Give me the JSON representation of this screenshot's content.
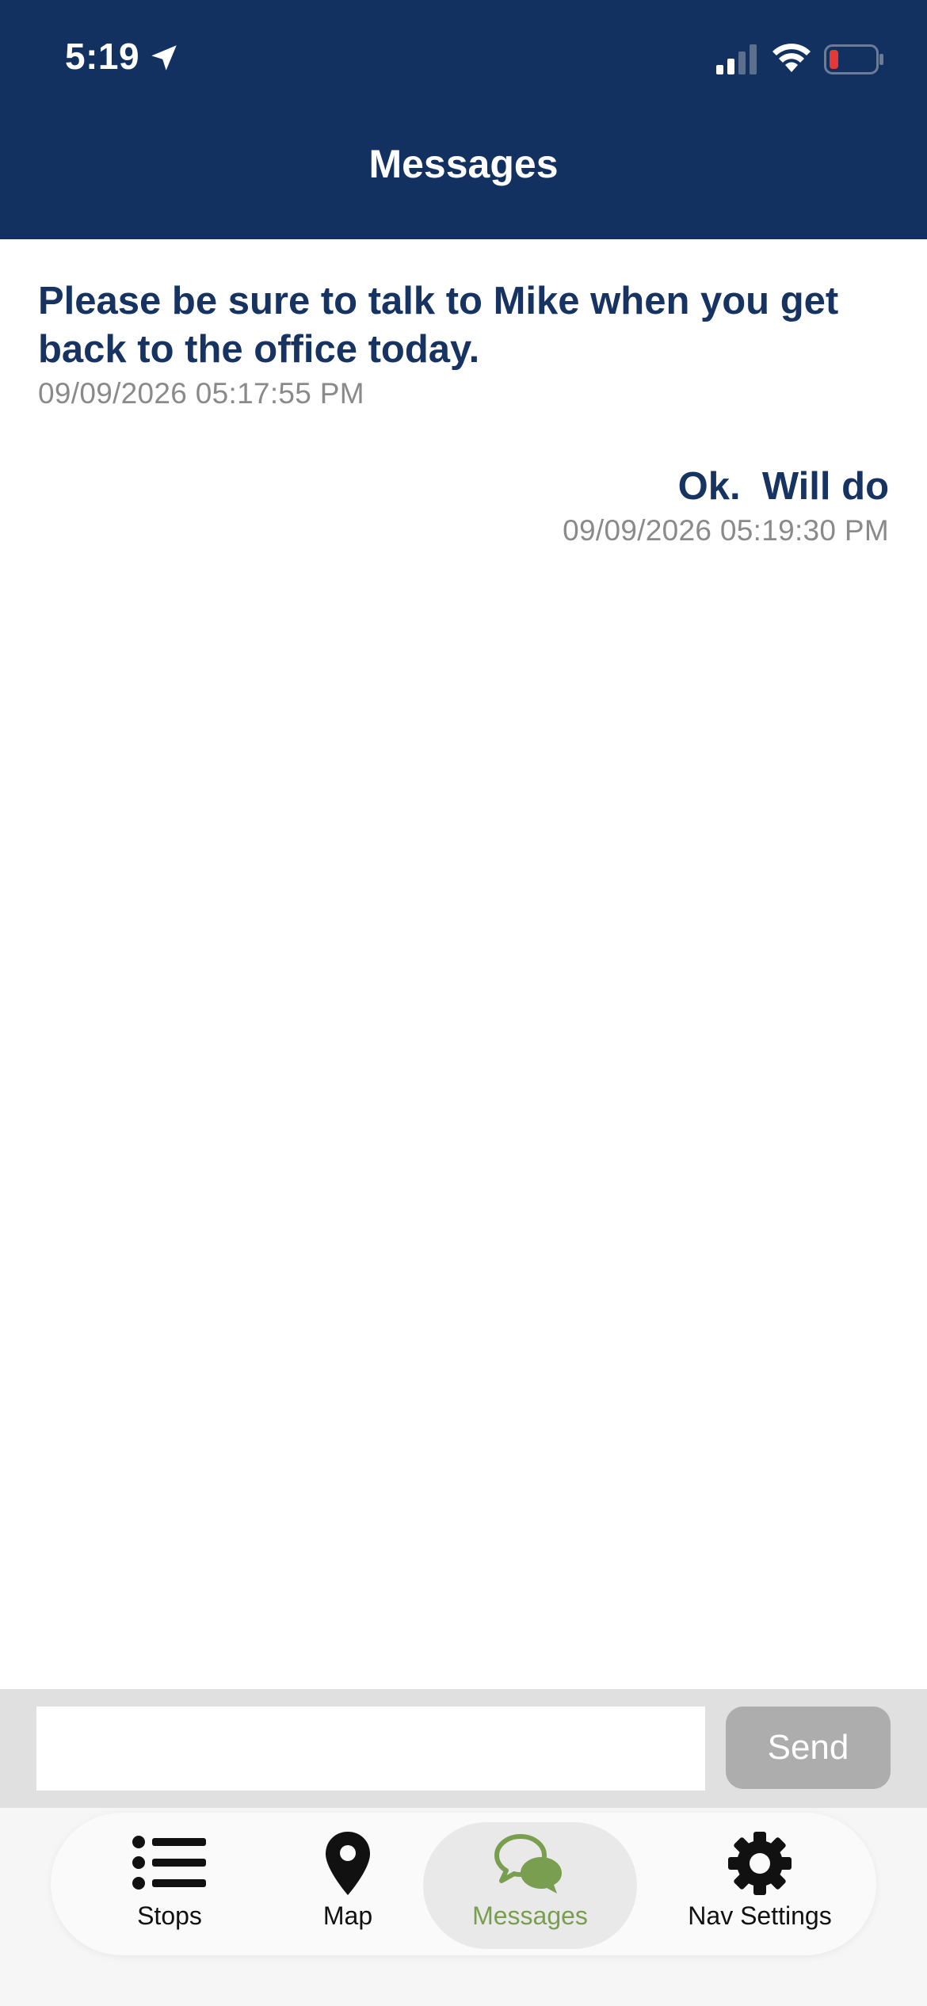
{
  "status_bar": {
    "time": "5:19"
  },
  "header": {
    "title": "Messages"
  },
  "messages": [
    {
      "direction": "incoming",
      "text": "Please be sure to talk to Mike when you get back to the office today.",
      "timestamp": "09/09/2026 05:17:55 PM"
    },
    {
      "direction": "outgoing",
      "text": "Ok.  Will do",
      "timestamp": "09/09/2026 05:19:30 PM"
    }
  ],
  "compose": {
    "input_value": "",
    "send_label": "Send"
  },
  "tabs": [
    {
      "label": "Stops",
      "icon": "list-icon",
      "active": false
    },
    {
      "label": "Map",
      "icon": "map-pin-icon",
      "active": false
    },
    {
      "label": "Messages",
      "icon": "chat-bubbles-icon",
      "active": true
    },
    {
      "label": "Nav Settings",
      "icon": "gear-icon",
      "active": false
    }
  ],
  "colors": {
    "header_bg": "#133160",
    "message_text": "#163362",
    "active_tab": "#7a9e4f",
    "send_button_bg": "#adadad",
    "battery_low": "#e53935"
  }
}
